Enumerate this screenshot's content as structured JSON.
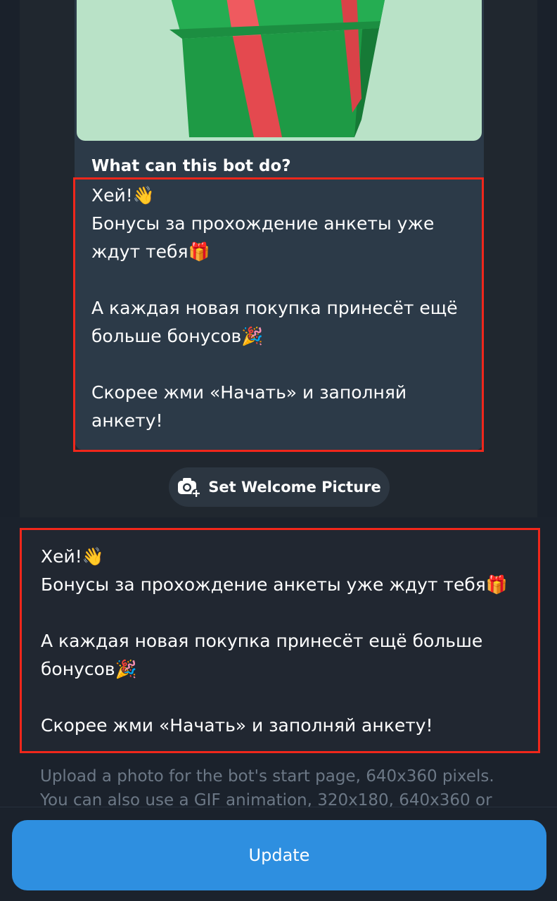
{
  "bot_card": {
    "title": "What can this bot do?",
    "text": "Хей!👋\nБонусы за прохождение анкеты уже\nждут тебя🎁\n\nА каждая новая покупка принесёт ещё\nбольше бонусов🎉\n\nСкорее жми «Начать» и заполняй\nанкету!",
    "image_icon": "gift-box-image"
  },
  "welcome_picture": {
    "label": "Set Welcome Picture",
    "icon": "camera-add-icon"
  },
  "description": {
    "value": "Хей!👋\nБонусы за прохождение анкеты уже ждут тебя🎁\n\nА каждая новая покупка принесёт ещё больше\nбонусов🎉\n\nСкорее жми «Начать» и заполняй анкету!"
  },
  "hint": {
    "text": "Upload a photo for the bot's start page, 640x360 pixels. You can also use a GIF animation, 320x180, 640x360 or"
  },
  "footer": {
    "update_label": "Update"
  },
  "colors": {
    "accent": "#2e8fe0",
    "highlight": "#f0271b",
    "card": "#2c3a48",
    "image_bg": "#b9e2c7"
  }
}
